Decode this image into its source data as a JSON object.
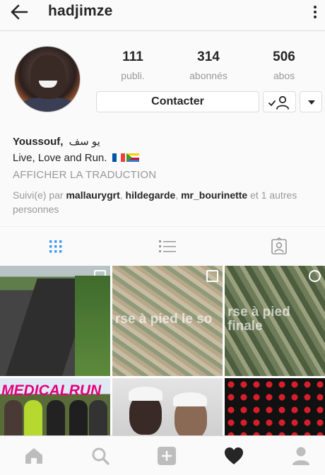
{
  "header": {
    "username": "hadjimze",
    "back_icon": "arrow-left-icon",
    "menu_icon": "more-vertical-icon"
  },
  "profile": {
    "stats": [
      {
        "value": "111",
        "label": "publi."
      },
      {
        "value": "314",
        "label": "abonnés"
      },
      {
        "value": "506",
        "label": "abos"
      }
    ],
    "contact_label": "Contacter",
    "name": "Youssouf,",
    "name_arabic": "يو سف",
    "bio": "Live, Love and Run.",
    "translate_label": "AFFICHER LA TRADUCTION",
    "followed_by_prefix": "Suivi(e) par",
    "followed_by": [
      "mallaurygrt",
      "hildegarde",
      "mr_bourinette"
    ],
    "followed_by_suffix": "et 1 autres personnes"
  },
  "tabs": [
    "grid-icon",
    "list-icon",
    "tagged-icon"
  ],
  "posts": {
    "items": [
      {
        "overlay": ""
      },
      {
        "overlay": "rse à pied le so"
      },
      {
        "overlay": "rse à pied\nfinale"
      },
      {
        "overlay": "MEDICALRUN"
      },
      {
        "overlay": ""
      },
      {
        "overlay": ""
      }
    ]
  },
  "bottom_nav": [
    "home-icon",
    "search-icon",
    "add-post-icon",
    "activity-heart-icon",
    "profile-icon"
  ]
}
